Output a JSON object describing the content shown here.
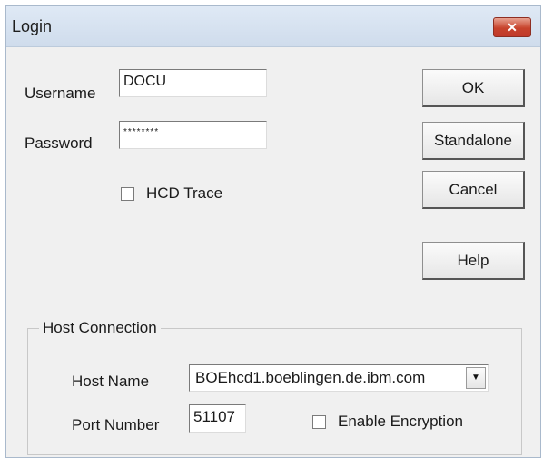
{
  "window": {
    "title": "Login",
    "close_glyph": "✕"
  },
  "form": {
    "username_label": "Username",
    "username_value": "DOCU",
    "password_label": "Password",
    "password_value": "********",
    "hcd_trace_label": "HCD Trace"
  },
  "buttons": {
    "ok": "OK",
    "standalone": "Standalone",
    "cancel": "Cancel",
    "help": "Help"
  },
  "host_connection": {
    "group_title": "Host Connection",
    "host_name_label": "Host Name",
    "host_name_value": "BOEhcd1.boeblingen.de.ibm.com",
    "port_number_label": "Port Number",
    "port_number_value": "51107",
    "encryption_label": "Enable Encryption"
  },
  "icons": {
    "dropdown": "chevron-down-icon",
    "close": "close-icon"
  },
  "colors": {
    "title_bar": "#d8e4f1",
    "close_button": "#c7432c",
    "dialog_bg": "#f0f0f0"
  }
}
